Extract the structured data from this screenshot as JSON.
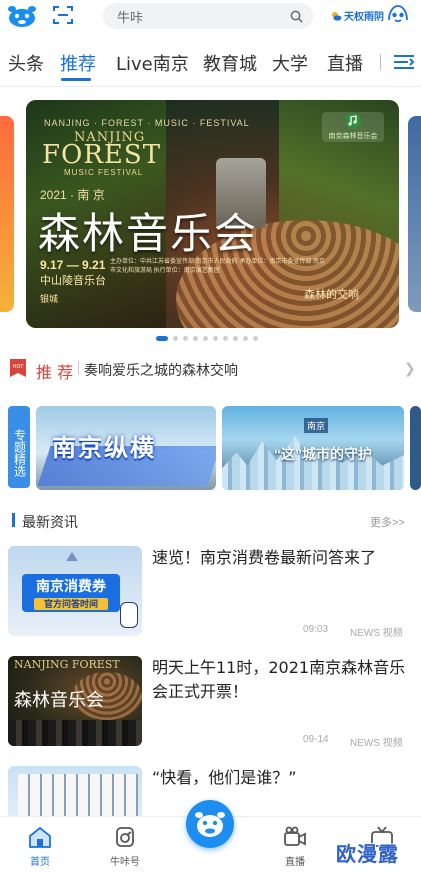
{
  "header": {
    "search_placeholder": "牛咔",
    "weather_text": "天权雨阴"
  },
  "tabs": [
    {
      "label": "头条"
    },
    {
      "label": "推荐"
    },
    {
      "label": "Live南京"
    },
    {
      "label": "教育城"
    },
    {
      "label": "大学"
    },
    {
      "label": "直播"
    }
  ],
  "active_tab": "推荐",
  "banner": {
    "season": "NANJING · FOREST · MUSIC · FESTIVAL",
    "en_line1": "NANJING",
    "en_line2": "FOREST",
    "en_line3": "MUSIC FESTIVAL",
    "year_city": "2021 · 南 京",
    "title": "森林音乐会",
    "dates": "9.17 — 9.21",
    "venue": "中山陵音乐台",
    "credits": "主办单位：中共江苏省委宣传部 南京市人民政府  承办单位：南京市委宣传部 南京市文化和旅游局  执行单位：南京演艺集团",
    "brand": "银城",
    "slogan": "森林的交响",
    "corner_badge": "南京森林音乐会"
  },
  "carousel": {
    "total_slides": 10,
    "active_index": 0
  },
  "recommend": {
    "label": "推 荐",
    "title": "奏响爱乐之城的森林交响"
  },
  "topics": {
    "tag": "专题精选",
    "cards": [
      {
        "text": "南京纵横"
      },
      {
        "text": "“这”城市的守护",
        "tag": "南京"
      }
    ]
  },
  "news": {
    "section_title": "最新资讯",
    "more_label": "更多>>",
    "items": [
      {
        "headline": "速览！南京消费卷最新问答来了",
        "time": "09:03",
        "source": "NEWS 视频",
        "thumb_title": "南京消费券",
        "thumb_sub": "官方问答时间"
      },
      {
        "headline": "明天上午11时，2021南京森林音乐会正式开票！",
        "time": "09-14",
        "source": "NEWS 视频",
        "thumb_title_en": "NANJING FOREST",
        "thumb_title_cn": "森林音乐会"
      },
      {
        "headline": "“快看，他们是谁？”",
        "time": "",
        "source": ""
      }
    ]
  },
  "bottom_nav": {
    "items": [
      {
        "label": "首页"
      },
      {
        "label": "牛咔号"
      },
      {
        "label": ""
      },
      {
        "label": "直播"
      },
      {
        "label": ""
      }
    ]
  },
  "watermark": "欧漫露",
  "colors": {
    "accent": "#1a72d8",
    "recommend_red": "#d8463b",
    "center_button": "#1d8ef0"
  }
}
